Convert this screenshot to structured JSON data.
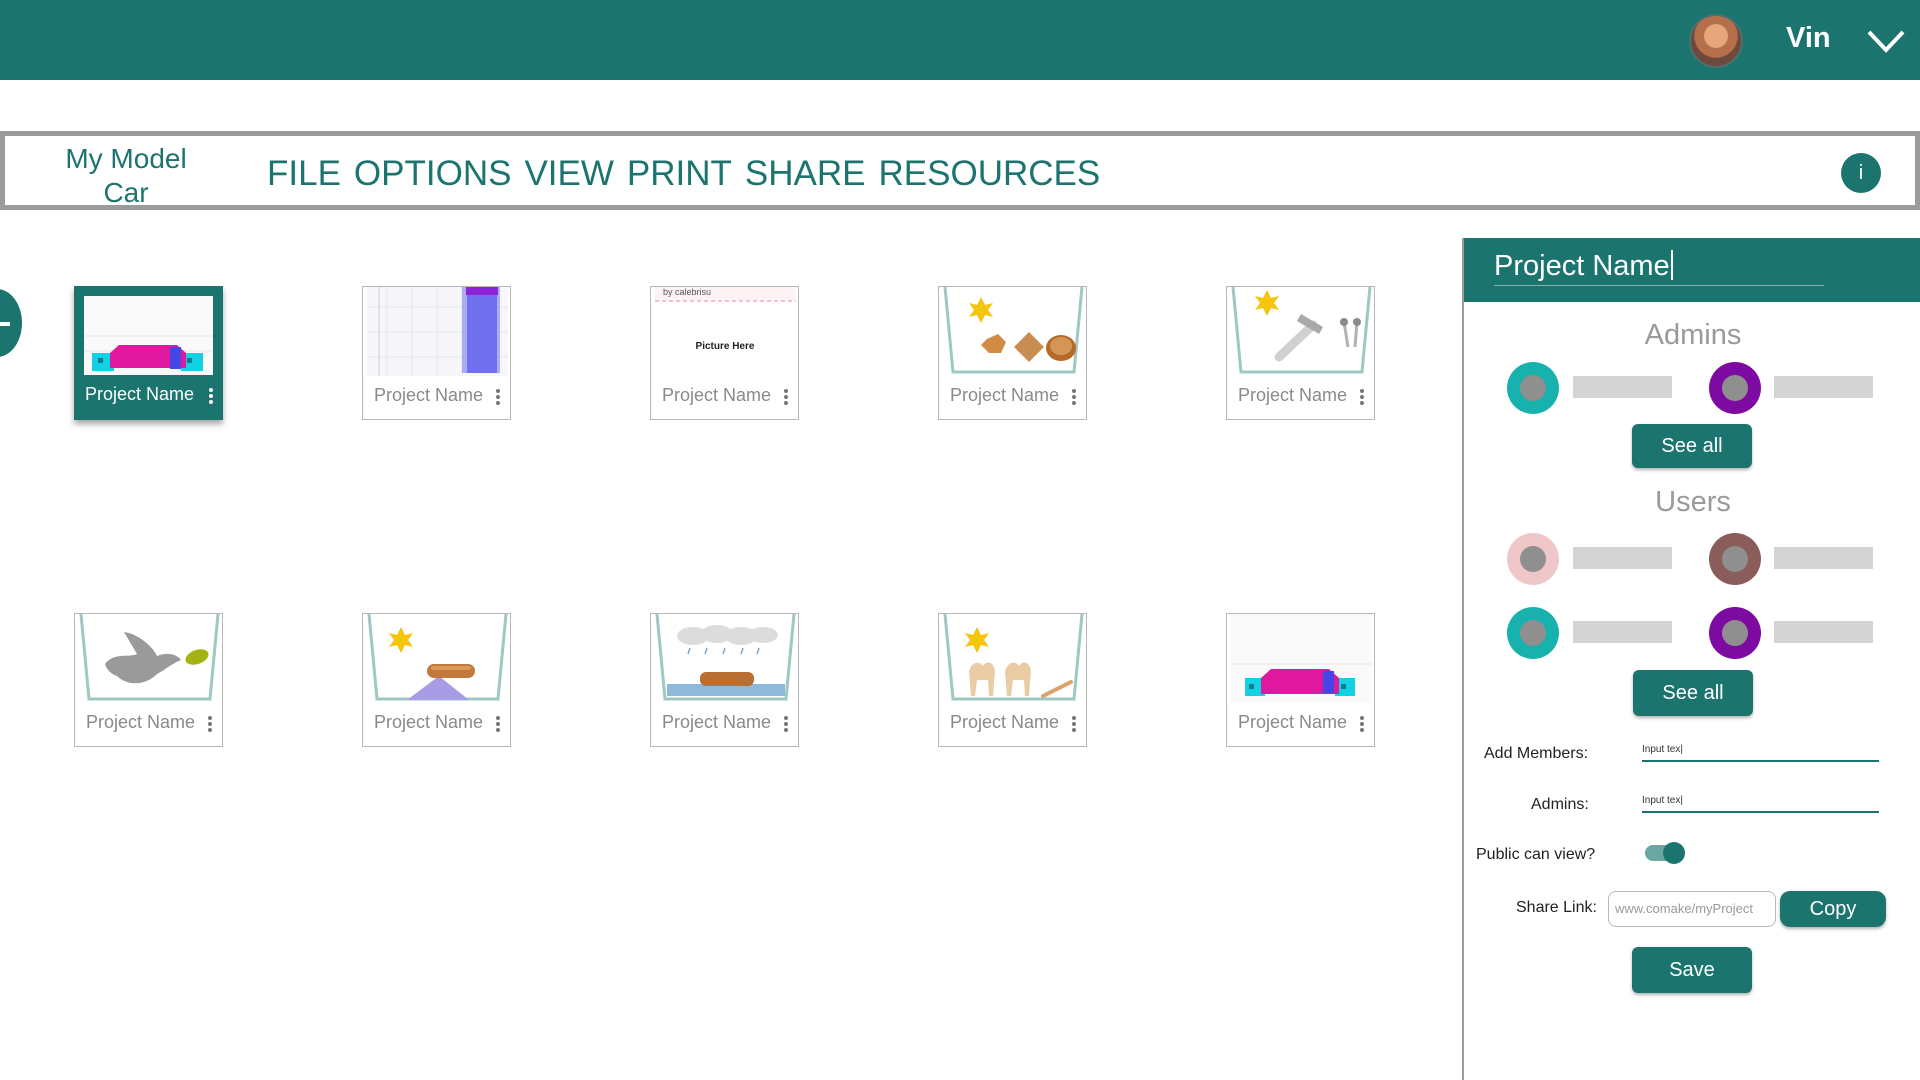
{
  "header": {
    "username": "Vin"
  },
  "menubar": {
    "project_title": "My Model Car",
    "items": [
      "FILE",
      "OPTIONS",
      "VIEW",
      "PRINT",
      "SHARE",
      "RESOURCES"
    ],
    "info_label": "i"
  },
  "projects": [
    {
      "label": "Project Name",
      "selected": true
    },
    {
      "label": "Project Name"
    },
    {
      "label": "Project Name",
      "thumb_caption": "Picture Here",
      "thumb_byline": "by calebrisu"
    },
    {
      "label": "Project Name"
    },
    {
      "label": "Project Name"
    },
    {
      "label": "Project Name"
    },
    {
      "label": "Project Name"
    },
    {
      "label": "Project Name"
    },
    {
      "label": "Project Name"
    },
    {
      "label": "Project Name"
    }
  ],
  "panel": {
    "project_name": "Project Name",
    "admins_title": "Admins",
    "users_title": "Users",
    "see_all_label": "See all",
    "add_members_label": "Add Members:",
    "add_members_value": "Input tex",
    "admins_label": "Admins:",
    "admins_value": "Input tex",
    "public_label": "Public can view?",
    "public_enabled": true,
    "share_link_label": "Share Link:",
    "share_link_value": "www.comake/myProject",
    "copy_label": "Copy",
    "save_label": "Save"
  },
  "colors": {
    "brand": "#1c746e",
    "admin_1": "#17b2ad",
    "admin_2": "#7d0ba2",
    "user_1": "#f0c7c9",
    "user_2": "#8b5d5a",
    "user_3": "#17b2ad",
    "user_4": "#7d0ba2"
  }
}
